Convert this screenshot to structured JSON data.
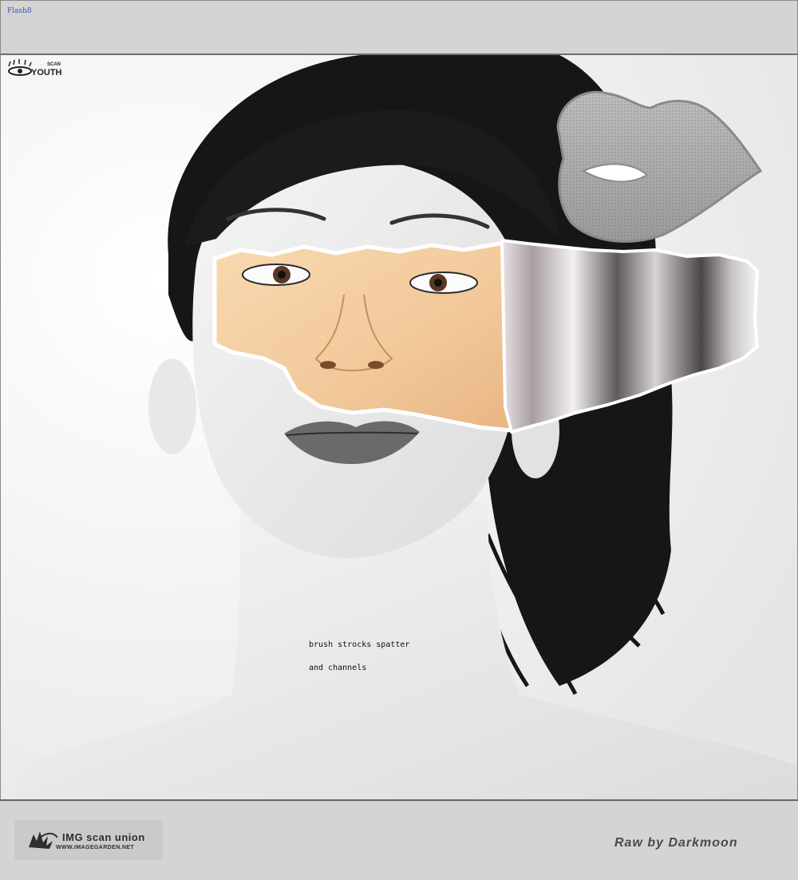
{
  "window": {
    "title": "Flash8"
  },
  "watermark": {
    "top_small": "SCAN",
    "top_big": "YOUTH"
  },
  "captions": {
    "line1": "brush strocks spatter",
    "line2": "and channels"
  },
  "footer": {
    "logo_main": "IMG scan union",
    "logo_url": "WWW.IMAGEGARDEN.NET",
    "credit": "Raw by Darkmoon"
  },
  "colors": {
    "chrome": "#d4d4d4",
    "border": "#6e6e6e",
    "title_text": "#3b55b8",
    "skin_tone": "#f2c89a",
    "footer_text": "#4a4a4a"
  },
  "icons": {
    "watermark": "eye-logo-icon",
    "lips": "lips-icon",
    "footer_logo": "splash-logo-icon"
  }
}
